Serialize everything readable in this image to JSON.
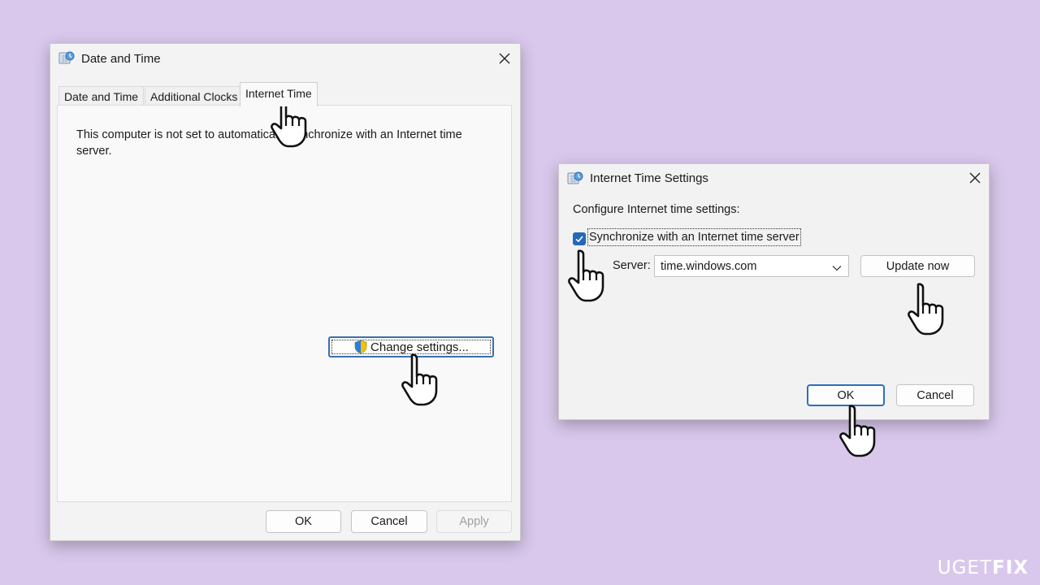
{
  "date_time_dialog": {
    "title": "Date and Time",
    "tabs": [
      {
        "label": "Date and Time"
      },
      {
        "label": "Additional Clocks"
      },
      {
        "label": "Internet Time"
      }
    ],
    "message": "This computer is not set to automatically synchronize with an Internet time server.",
    "change_settings_label": "Change settings...",
    "ok_label": "OK",
    "cancel_label": "Cancel",
    "apply_label": "Apply"
  },
  "internet_time_dialog": {
    "title": "Internet Time Settings",
    "heading": "Configure Internet time settings:",
    "sync_checkbox_label": "Synchronize with an Internet time server",
    "sync_checked": true,
    "server_label": "Server:",
    "server_value": "time.windows.com",
    "update_now_label": "Update now",
    "ok_label": "OK",
    "cancel_label": "Cancel"
  },
  "watermark": {
    "text_a": "UG",
    "text_b": "ET",
    "text_c": "FIX"
  },
  "colors": {
    "background": "#d9c8ec",
    "accent": "#2469b8"
  },
  "icons": [
    "clock-globe-icon",
    "close-icon",
    "uac-shield-icon",
    "checkmark-icon",
    "chevron-down-icon",
    "pointer-hand-icon"
  ]
}
